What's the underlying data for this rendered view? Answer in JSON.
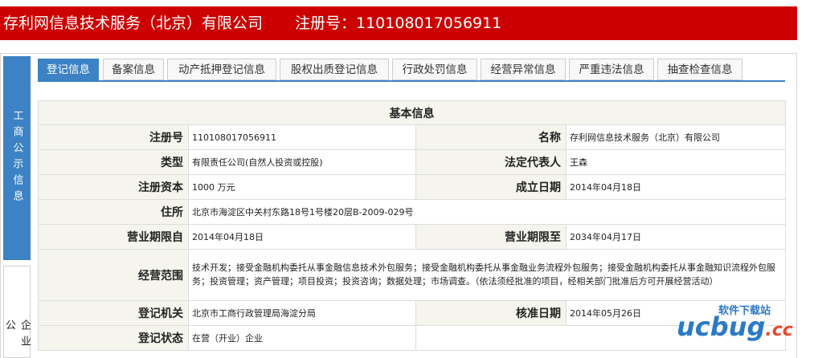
{
  "header": {
    "company": "存利网信息技术服务（北京）有限公司",
    "reg_no": "注册号：110108017056911"
  },
  "sidebar": {
    "primary": "工商公示信息",
    "secondary": "企业公"
  },
  "tabs": [
    {
      "label": "登记信息",
      "active": true
    },
    {
      "label": "备案信息",
      "active": false
    },
    {
      "label": "动产抵押登记信息",
      "active": false
    },
    {
      "label": "股权出质登记信息",
      "active": false
    },
    {
      "label": "行政处罚信息",
      "active": false
    },
    {
      "label": "经营异常信息",
      "active": false
    },
    {
      "label": "严重违法信息",
      "active": false
    },
    {
      "label": "抽查检查信息",
      "active": false
    }
  ],
  "basic_info": {
    "title": "基本信息",
    "reg_no_label": "注册号",
    "reg_no": "110108017056911",
    "name_label": "名称",
    "name": "存利网信息技术服务（北京）有限公司",
    "type_label": "类型",
    "type": "有限责任公司(自然人投资或控股)",
    "legal_rep_label": "法定代表人",
    "legal_rep": "王森",
    "capital_label": "注册资本",
    "capital": "1000 万元",
    "established_label": "成立日期",
    "established": "2014年04月18日",
    "address_label": "住所",
    "address": "北京市海淀区中关村东路18号1号楼20层B-2009-029号",
    "term_from_label": "营业期限自",
    "term_from": "2014年04月18日",
    "term_to_label": "营业期限至",
    "term_to": "2034年04月17日",
    "scope_label": "经营范围",
    "scope": "技术开发；接受金融机构委托从事金融信息技术外包服务；接受金融机构委托从事金融业务流程外包服务；接受金融机构委托从事金融知识流程外包服务；投资管理；资产管理；项目投资；投资咨询；数据处理；市场调查。（依法须经批准的项目，经相关部门批准后方可开展经营活动）",
    "authority_label": "登记机关",
    "authority": "北京市工商行政管理局海淀分局",
    "approval_label": "核准日期",
    "approval": "2014年05月26日",
    "status_label": "登记状态",
    "status": "在营（开业）企业"
  },
  "watermark": {
    "top": "软件下载站",
    "logo_a": "ucbug",
    "logo_b": ".cc"
  },
  "colors": {
    "header_red": "#cc0000",
    "tab_blue": "#3c82c4",
    "label_bg": "#f5f5ee"
  }
}
